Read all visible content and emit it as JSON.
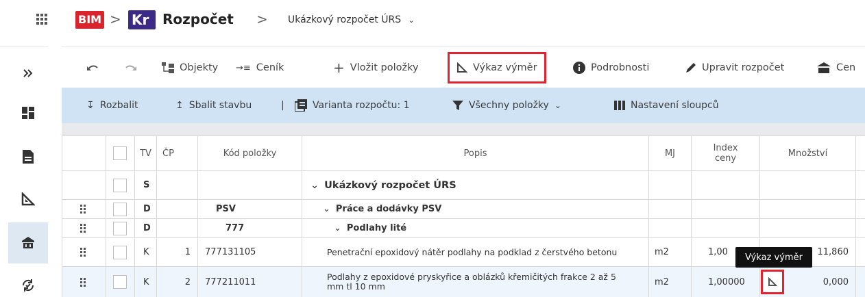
{
  "header": {
    "apps_icon": "grid-icon",
    "logo_bim": "BIM",
    "logo_kr": "Kr",
    "app_title": "Rozpočet",
    "project": "Ukázkový rozpočet ÚRS",
    "project_dropdown_icon": "chevron-down-icon"
  },
  "rail": {
    "items": [
      {
        "icon": "expand-double-chevron-icon"
      },
      {
        "icon": "dashboard-icon"
      },
      {
        "icon": "document-icon"
      },
      {
        "icon": "ruler-triangle-icon"
      },
      {
        "icon": "building-icon",
        "active": true
      },
      {
        "icon": "sync-icon"
      }
    ]
  },
  "toolbar": {
    "undo": "undo-icon",
    "redo": "redo-icon",
    "objekty": "Objekty",
    "cenik": "Ceník",
    "vlozit": "Vložit položky",
    "vykaz": "Výkaz výměr",
    "podrobnosti": "Podrobnosti",
    "upravit": "Upravit rozpočet",
    "cen": "Cen"
  },
  "subbar": {
    "rozbalit": "Rozbalit",
    "sbalit": "Sbalit stavbu",
    "separator": "|",
    "varianta": "Varianta rozpočtu: 1",
    "filter": "Všechny položky",
    "sloupce": "Nastavení sloupců"
  },
  "table": {
    "headers": {
      "tv": "TV",
      "cp": "ČP",
      "kod": "Kód položky",
      "popis": "Popis",
      "mj": "MJ",
      "index_line1": "Index",
      "index_line2": "ceny",
      "mnozstvi": "Množství"
    },
    "rows": [
      {
        "tv": "S",
        "cp": "",
        "kod": "",
        "popis": "Ukázkový rozpočet ÚRS",
        "mj": "",
        "index": "",
        "mnozstvi": ""
      },
      {
        "tv": "D",
        "cp": "",
        "kod": "PSV",
        "popis": "Práce a dodávky PSV",
        "mj": "",
        "index": "",
        "mnozstvi": ""
      },
      {
        "tv": "D",
        "cp": "",
        "kod": "777",
        "popis": "Podlahy lité",
        "mj": "",
        "index": "",
        "mnozstvi": ""
      },
      {
        "tv": "K",
        "cp": "1",
        "kod": "777131105",
        "popis": "Penetrační epoxidový nátěr podlahy na podklad z čerstvého betonu",
        "mj": "m2",
        "index": "1,00",
        "mnozstvi": "11,860"
      },
      {
        "tv": "K",
        "cp": "2",
        "kod": "777211011",
        "popis": "Podlahy z epoxidové pryskyřice a oblázků křemičitých frakce 2 až 5 mm tl 10 mm",
        "mj": "m2",
        "index": "1,00000",
        "mnozstvi": "0,000"
      }
    ]
  },
  "tooltip": "Výkaz výměr",
  "colors": {
    "accent_red": "#e0232e",
    "bim_red": "#d9232d",
    "kr_purple": "#3b2a86",
    "subbar_blue": "#cfe3f5",
    "link_blue": "#3f7dd6"
  }
}
